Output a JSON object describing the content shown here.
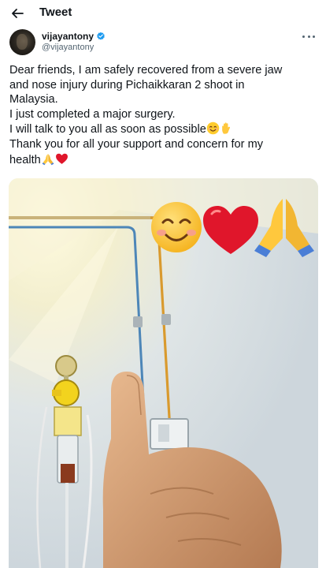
{
  "header": {
    "title": "Tweet"
  },
  "tweet": {
    "author": {
      "display_name": "vijayantony",
      "handle": "@vijayantony",
      "verified": true
    },
    "lines": [
      "Dear friends, I am safely recovered from a severe jaw",
      "and nose injury during Pichaikkaran 2 shoot in",
      "Malaysia.",
      "I just completed a major surgery.",
      "I will talk to you all as soon as possible",
      "Thank you for all your support and concern for my",
      "health"
    ],
    "emojis": {
      "line5": [
        "smiling-face-emoji",
        "raised-hand-emoji"
      ],
      "line7": [
        "folded-hands-emoji",
        "red-heart-emoji"
      ]
    },
    "media": {
      "overlay_emojis": [
        "smiling-face-emoji",
        "red-heart-emoji",
        "folded-hands-emoji"
      ]
    }
  },
  "colors": {
    "text": "#0f1419",
    "secondary": "#536471",
    "verified": "#1d9bf0",
    "heart": "#e0162b",
    "emoji_yellow": "#ffcc2e"
  }
}
